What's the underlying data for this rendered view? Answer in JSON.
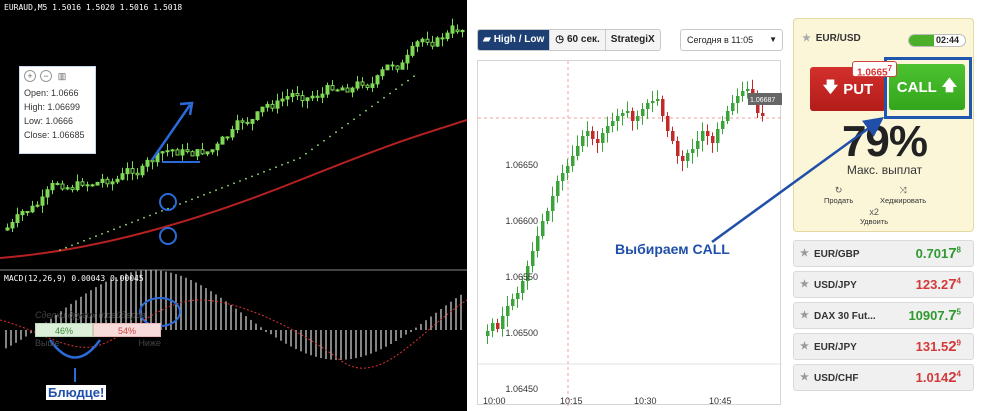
{
  "mt4": {
    "title": "EURAUD,M5  1.5016 1.5020 1.5016 1.5018",
    "macd_title": "MACD(12,26,9) 0.00043 0.00045",
    "annotation": "Блюдце!"
  },
  "binary_chart": {
    "tabs": [
      {
        "label": "High / Low",
        "icon": "chart-icon"
      },
      {
        "label": "60 сек.",
        "icon": "clock-icon"
      },
      {
        "label": "StrategiX",
        "icon": ""
      }
    ],
    "date_select": "Сегодня в 11:05",
    "y_ticks": [
      "1.06650",
      "1.06600",
      "1.06550",
      "1.06500",
      "1.06450"
    ],
    "x_ticks": [
      "10:00",
      "10:15",
      "10:30",
      "10:45"
    ],
    "current_price_tag": "1.06687",
    "ohlc": {
      "open": "Open: 1.0666",
      "high": "High: 1.06699",
      "low": "Low: 1.0666",
      "close": "Close: 1.06685"
    },
    "other_traders": {
      "title": "Сделки других трейдеров",
      "up_pct": "46%",
      "down_pct": "54%",
      "up_label": "Выше",
      "down_label": "Ниже",
      "up_fraction": 0.46
    },
    "annotation": "Выбираем CALL"
  },
  "trade_panel": {
    "pair": "EUR/USD",
    "timer": "02:44",
    "timer_fraction": 0.45,
    "put_label": "PUT",
    "call_label": "CALL",
    "rate_main": "1.0665",
    "rate_sup": "7",
    "payout_pct": "79%",
    "payout_label": "Макс. выплат",
    "sell_label": "Продать",
    "hedge_label": "Хеджировать",
    "double_x": "x2",
    "double_label": "Удвоить"
  },
  "assets": [
    {
      "name": "EUR/GBP",
      "price": "0.701",
      "sup": "8",
      "big": "7",
      "color": "#2e9a2e"
    },
    {
      "name": "USD/JPY",
      "price": "123.2",
      "sup": "4",
      "big": "7",
      "color": "#d23a3a"
    },
    {
      "name": "DAX 30 Fut...",
      "price": "10907.",
      "sup": "5",
      "big": "7",
      "color": "#2e9a2e"
    },
    {
      "name": "EUR/JPY",
      "price": "131.5",
      "sup": "9",
      "big": "2",
      "color": "#d23a3a"
    },
    {
      "name": "USD/CHF",
      "price": "1.014",
      "sup": "4",
      "big": "2",
      "color": "#d23a3a"
    }
  ],
  "colors": {
    "bull": "#7ed957",
    "bear": "#c22a2a",
    "accent": "#1f4fa8",
    "put": "#c72621",
    "call": "#3db425"
  }
}
